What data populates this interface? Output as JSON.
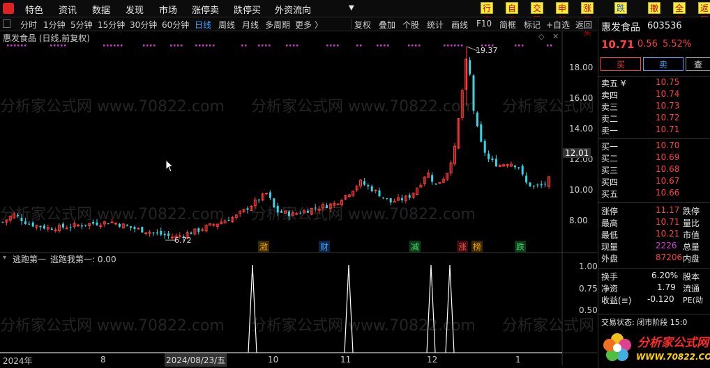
{
  "menu": {
    "items": [
      "特色",
      "资讯",
      "数据",
      "发现",
      "市场",
      "涨停卖",
      "跌停买",
      "外资流向"
    ],
    "buttons": [
      "行情",
      "自选",
      "交易",
      "申新",
      "涨停买",
      "跌停卖",
      "撤单",
      "全撤",
      "返回"
    ]
  },
  "toolbar": {
    "periods": [
      "分时",
      "1分钟",
      "5分钟",
      "15分钟",
      "30分钟",
      "60分钟",
      "日线",
      "周线",
      "月线",
      "多周期",
      "更多 〉"
    ],
    "active_period": "日线",
    "tools": [
      "复权",
      "叠加",
      "个股",
      "统计",
      "画线",
      "F10",
      "简框",
      "标记",
      "+自选",
      "返回"
    ]
  },
  "main_chart": {
    "title": "惠发食品 (日线,前复权)",
    "price_axis": [
      "18.00",
      "16.00",
      "14.00",
      "12.00",
      "10.00",
      "8.00"
    ],
    "price_highlight": "12.01",
    "high_label": "19.37",
    "low_label": "6.72",
    "event_tags": [
      "激",
      "财",
      "减",
      "涨",
      "榜",
      "跌"
    ]
  },
  "indicator": {
    "title": "逃跑第一",
    "value_line": "逃跑我第一: 0.00",
    "axis": [
      "1.00",
      "0.75",
      "0.50"
    ]
  },
  "date_axis": [
    "2024年",
    "8",
    "2024/08/23/五",
    "10",
    "11",
    "12",
    "1"
  ],
  "watermark": "分析家公式网 www.70822.com",
  "stock": {
    "name": "惠发食品",
    "code": "603536",
    "price": "10.71",
    "change": "0.56",
    "pct": "5.52%",
    "buy_label": "买",
    "sell_label": "卖",
    "check_label": "查"
  },
  "order_book": {
    "asks": [
      {
        "label": "卖五 ¥",
        "price": "10.75"
      },
      {
        "label": "卖四",
        "price": "10.74"
      },
      {
        "label": "卖三",
        "price": "10.73"
      },
      {
        "label": "卖二",
        "price": "10.72"
      },
      {
        "label": "卖一",
        "price": "10.71"
      }
    ],
    "bids": [
      {
        "label": "买一",
        "price": "10.70"
      },
      {
        "label": "买二",
        "price": "10.69"
      },
      {
        "label": "买三",
        "price": "10.68"
      },
      {
        "label": "买四",
        "price": "10.67"
      },
      {
        "label": "买五",
        "price": "10.66"
      }
    ]
  },
  "stats": [
    {
      "label": "涨停",
      "value": "11.17",
      "label2": "跌停"
    },
    {
      "label": "最高",
      "value": "10.71",
      "label2": "量比"
    },
    {
      "label": "最低",
      "value": "10.21",
      "label2": "市值"
    },
    {
      "label": "现量",
      "value": "2226",
      "label2": "总量"
    },
    {
      "label": "外盘",
      "value": "87206",
      "label2": "内盘"
    }
  ],
  "stats2": [
    {
      "label": "换手",
      "value": "6.20%",
      "label2": "股本"
    },
    {
      "label": "净资",
      "value": "1.79",
      "label2": "流通"
    },
    {
      "label": "收益(≡)",
      "value": "-0.120",
      "label2": "PE(动"
    }
  ],
  "trade_status": "交易状态: 闭市阶段 15:0",
  "logo": {
    "text1": "分析家公式网",
    "text2": "WWW.70822.COM"
  },
  "colors": {
    "up": "#ff3b3b",
    "down": "#35d6e6",
    "accent": "#3fa0ff",
    "marker": "#d63bd6"
  }
}
